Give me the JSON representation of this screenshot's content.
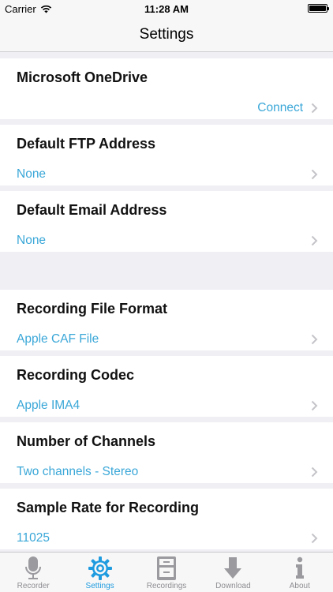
{
  "status_bar": {
    "carrier": "Carrier",
    "time": "11:28 AM"
  },
  "nav": {
    "title": "Settings"
  },
  "rows": [
    {
      "label": "Microsoft OneDrive",
      "value": "Connect"
    },
    {
      "label": "Default FTP Address",
      "value": "None"
    },
    {
      "label": "Default Email Address",
      "value": "None"
    },
    {
      "label": "Recording File Format",
      "value": "Apple CAF File"
    },
    {
      "label": "Recording Codec",
      "value": "Apple IMA4"
    },
    {
      "label": "Number of Channels",
      "value": "Two channels - Stereo"
    },
    {
      "label": "Sample Rate for Recording",
      "value": "11025"
    }
  ],
  "tabs": [
    {
      "label": "Recorder",
      "icon": "microphone-icon"
    },
    {
      "label": "Settings",
      "icon": "gear-icon",
      "active": true
    },
    {
      "label": "Recordings",
      "icon": "file-cabinet-icon"
    },
    {
      "label": "Download",
      "icon": "download-arrow-icon"
    },
    {
      "label": "About",
      "icon": "info-icon"
    }
  ],
  "colors": {
    "accent": "#3aa7d8",
    "tab_active": "#1f9be0",
    "tab_inactive": "#8e8e93",
    "background": "#efeff4"
  }
}
